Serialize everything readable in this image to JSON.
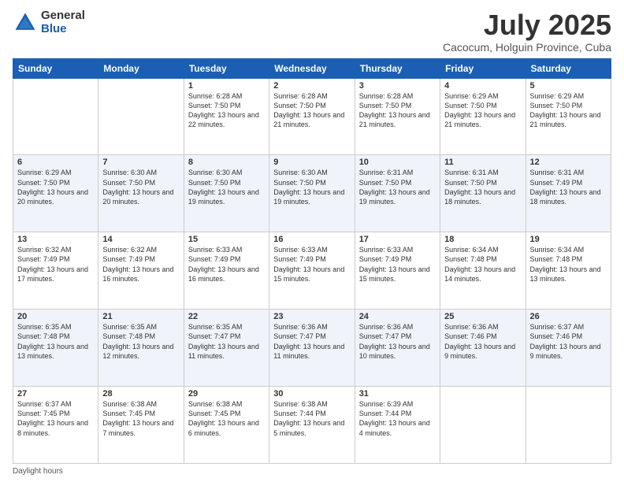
{
  "logo": {
    "general": "General",
    "blue": "Blue"
  },
  "title": "July 2025",
  "subtitle": "Cacocum, Holguin Province, Cuba",
  "days_header": [
    "Sunday",
    "Monday",
    "Tuesday",
    "Wednesday",
    "Thursday",
    "Friday",
    "Saturday"
  ],
  "footer_text": "Daylight hours",
  "weeks": [
    [
      {
        "num": "",
        "info": ""
      },
      {
        "num": "",
        "info": ""
      },
      {
        "num": "1",
        "info": "Sunrise: 6:28 AM\nSunset: 7:50 PM\nDaylight: 13 hours and 22 minutes."
      },
      {
        "num": "2",
        "info": "Sunrise: 6:28 AM\nSunset: 7:50 PM\nDaylight: 13 hours and 21 minutes."
      },
      {
        "num": "3",
        "info": "Sunrise: 6:28 AM\nSunset: 7:50 PM\nDaylight: 13 hours and 21 minutes."
      },
      {
        "num": "4",
        "info": "Sunrise: 6:29 AM\nSunset: 7:50 PM\nDaylight: 13 hours and 21 minutes."
      },
      {
        "num": "5",
        "info": "Sunrise: 6:29 AM\nSunset: 7:50 PM\nDaylight: 13 hours and 21 minutes."
      }
    ],
    [
      {
        "num": "6",
        "info": "Sunrise: 6:29 AM\nSunset: 7:50 PM\nDaylight: 13 hours and 20 minutes."
      },
      {
        "num": "7",
        "info": "Sunrise: 6:30 AM\nSunset: 7:50 PM\nDaylight: 13 hours and 20 minutes."
      },
      {
        "num": "8",
        "info": "Sunrise: 6:30 AM\nSunset: 7:50 PM\nDaylight: 13 hours and 19 minutes."
      },
      {
        "num": "9",
        "info": "Sunrise: 6:30 AM\nSunset: 7:50 PM\nDaylight: 13 hours and 19 minutes."
      },
      {
        "num": "10",
        "info": "Sunrise: 6:31 AM\nSunset: 7:50 PM\nDaylight: 13 hours and 19 minutes."
      },
      {
        "num": "11",
        "info": "Sunrise: 6:31 AM\nSunset: 7:50 PM\nDaylight: 13 hours and 18 minutes."
      },
      {
        "num": "12",
        "info": "Sunrise: 6:31 AM\nSunset: 7:49 PM\nDaylight: 13 hours and 18 minutes."
      }
    ],
    [
      {
        "num": "13",
        "info": "Sunrise: 6:32 AM\nSunset: 7:49 PM\nDaylight: 13 hours and 17 minutes."
      },
      {
        "num": "14",
        "info": "Sunrise: 6:32 AM\nSunset: 7:49 PM\nDaylight: 13 hours and 16 minutes."
      },
      {
        "num": "15",
        "info": "Sunrise: 6:33 AM\nSunset: 7:49 PM\nDaylight: 13 hours and 16 minutes."
      },
      {
        "num": "16",
        "info": "Sunrise: 6:33 AM\nSunset: 7:49 PM\nDaylight: 13 hours and 15 minutes."
      },
      {
        "num": "17",
        "info": "Sunrise: 6:33 AM\nSunset: 7:49 PM\nDaylight: 13 hours and 15 minutes."
      },
      {
        "num": "18",
        "info": "Sunrise: 6:34 AM\nSunset: 7:48 PM\nDaylight: 13 hours and 14 minutes."
      },
      {
        "num": "19",
        "info": "Sunrise: 6:34 AM\nSunset: 7:48 PM\nDaylight: 13 hours and 13 minutes."
      }
    ],
    [
      {
        "num": "20",
        "info": "Sunrise: 6:35 AM\nSunset: 7:48 PM\nDaylight: 13 hours and 13 minutes."
      },
      {
        "num": "21",
        "info": "Sunrise: 6:35 AM\nSunset: 7:48 PM\nDaylight: 13 hours and 12 minutes."
      },
      {
        "num": "22",
        "info": "Sunrise: 6:35 AM\nSunset: 7:47 PM\nDaylight: 13 hours and 11 minutes."
      },
      {
        "num": "23",
        "info": "Sunrise: 6:36 AM\nSunset: 7:47 PM\nDaylight: 13 hours and 11 minutes."
      },
      {
        "num": "24",
        "info": "Sunrise: 6:36 AM\nSunset: 7:47 PM\nDaylight: 13 hours and 10 minutes."
      },
      {
        "num": "25",
        "info": "Sunrise: 6:36 AM\nSunset: 7:46 PM\nDaylight: 13 hours and 9 minutes."
      },
      {
        "num": "26",
        "info": "Sunrise: 6:37 AM\nSunset: 7:46 PM\nDaylight: 13 hours and 9 minutes."
      }
    ],
    [
      {
        "num": "27",
        "info": "Sunrise: 6:37 AM\nSunset: 7:45 PM\nDaylight: 13 hours and 8 minutes."
      },
      {
        "num": "28",
        "info": "Sunrise: 6:38 AM\nSunset: 7:45 PM\nDaylight: 13 hours and 7 minutes."
      },
      {
        "num": "29",
        "info": "Sunrise: 6:38 AM\nSunset: 7:45 PM\nDaylight: 13 hours and 6 minutes."
      },
      {
        "num": "30",
        "info": "Sunrise: 6:38 AM\nSunset: 7:44 PM\nDaylight: 13 hours and 5 minutes."
      },
      {
        "num": "31",
        "info": "Sunrise: 6:39 AM\nSunset: 7:44 PM\nDaylight: 13 hours and 4 minutes."
      },
      {
        "num": "",
        "info": ""
      },
      {
        "num": "",
        "info": ""
      }
    ]
  ]
}
